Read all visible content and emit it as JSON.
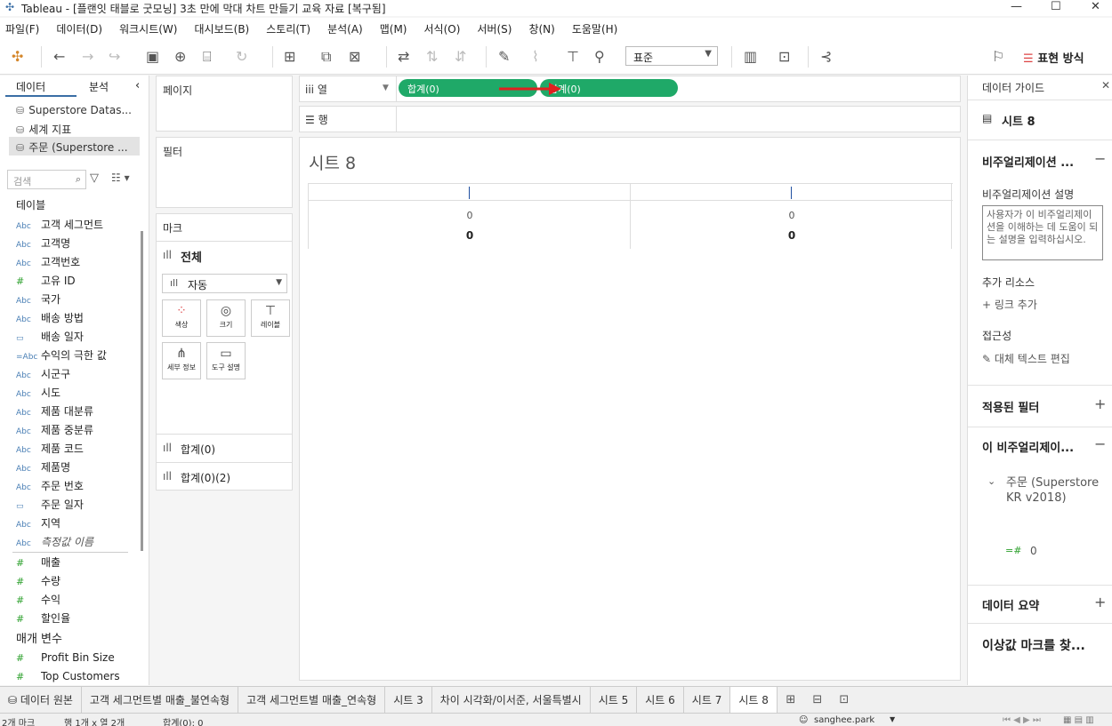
{
  "window": {
    "title": "Tableau - [플랜잇 태블로 굿모닝] 3초 만에 막대 차트 만들기 교육 자료 [복구됨]"
  },
  "menu": [
    "파일(F)",
    "데이터(D)",
    "워크시트(W)",
    "대시보드(B)",
    "스토리(T)",
    "분석(A)",
    "맵(M)",
    "서식(O)",
    "서버(S)",
    "창(N)",
    "도움말(H)"
  ],
  "toolbar": {
    "fit": "표준",
    "show_me": "표현 방식"
  },
  "left": {
    "tab_data": "데이터",
    "tab_analysis": "분석",
    "sources": [
      "Superstore Datas...",
      "세계 지표",
      "주문 (Superstore ..."
    ],
    "search_placeholder": "검색",
    "tables_header": "테이블",
    "dimensions": [
      {
        "type": "Abc",
        "name": "고객 세그먼트"
      },
      {
        "type": "Abc",
        "name": "고객명"
      },
      {
        "type": "Abc",
        "name": "고객번호"
      },
      {
        "type": "#",
        "name": "고유 ID"
      },
      {
        "type": "Abc",
        "name": "국가"
      },
      {
        "type": "Abc",
        "name": "배송 방법"
      },
      {
        "type": "date",
        "name": "배송 일자"
      },
      {
        "type": "=Abc",
        "name": "수익의 극한 값"
      },
      {
        "type": "Abc",
        "name": "시군구"
      },
      {
        "type": "Abc",
        "name": "시도"
      },
      {
        "type": "Abc",
        "name": "제품 대분류"
      },
      {
        "type": "Abc",
        "name": "제품 중분류"
      },
      {
        "type": "Abc",
        "name": "제품 코드"
      },
      {
        "type": "Abc",
        "name": "제품명"
      },
      {
        "type": "Abc",
        "name": "주문 번호"
      },
      {
        "type": "date",
        "name": "주문 일자"
      },
      {
        "type": "Abc",
        "name": "지역"
      },
      {
        "type": "Abc",
        "name": "측정값 이름"
      }
    ],
    "measures": [
      {
        "type": "#",
        "name": "매출"
      },
      {
        "type": "#",
        "name": "수량"
      },
      {
        "type": "#",
        "name": "수익"
      },
      {
        "type": "#",
        "name": "할인율"
      }
    ],
    "params_header": "매개 변수",
    "params": [
      {
        "type": "#",
        "name": "Profit Bin Size"
      },
      {
        "type": "#",
        "name": "Top Customers"
      }
    ]
  },
  "shelves": {
    "pages": "페이지",
    "filters": "필터",
    "marks": "마크",
    "marks_all": "전체",
    "mark_type": "자동",
    "mark_buttons": [
      "색상",
      "크기",
      "레이블",
      "세부 정보",
      "도구 설명"
    ],
    "marks_cards": [
      "합계(0)",
      "합계(0)(2)"
    ],
    "columns_label": "열",
    "rows_label": "행",
    "column_pills": [
      "합계(0)",
      "합계(0)"
    ]
  },
  "view": {
    "sheet_title": "시트 8",
    "cells": [
      {
        "v1": "0",
        "v2": "0"
      },
      {
        "v1": "0",
        "v2": "0"
      }
    ]
  },
  "right": {
    "title": "데이터 가이드",
    "sheet": "시트 8",
    "viz_desc_header": "비주얼리제이션 ...",
    "viz_desc_label": "비주얼리제이션 설명",
    "viz_desc_placeholder": "사용자가 이 비주얼리제이션을 이해하는 데 도움이 되는 설명을 입력하십시오.",
    "extra_resources": "추가 리소스",
    "add_link": "링크 추가",
    "accessibility": "접근성",
    "edit_alt": "대체 텍스트 편집",
    "applied_filters": "적용된 필터",
    "this_viz": "이 비주얼리제이...",
    "source_name": "주문 (Superstore KR v2018)",
    "field_value": "0",
    "data_summary": "데이터 요약",
    "outliers": "이상값 마크를 찾..."
  },
  "tabs": [
    "데이터 원본",
    "고객 세그먼트별 매출_불연속형",
    "고객 세그먼트별 매출_연속형",
    "시트 3",
    "차이 시각화/이서준, 서울특별시",
    "시트 5",
    "시트 6",
    "시트 7",
    "시트 8"
  ],
  "status": {
    "marks": "2개 마크",
    "rows_cols": "행 1개 x 열 2개",
    "sum": "합계(0): 0",
    "user": "sanghee.park"
  },
  "colors": {
    "pill": "#1fa968",
    "arrow": "#e02020"
  }
}
